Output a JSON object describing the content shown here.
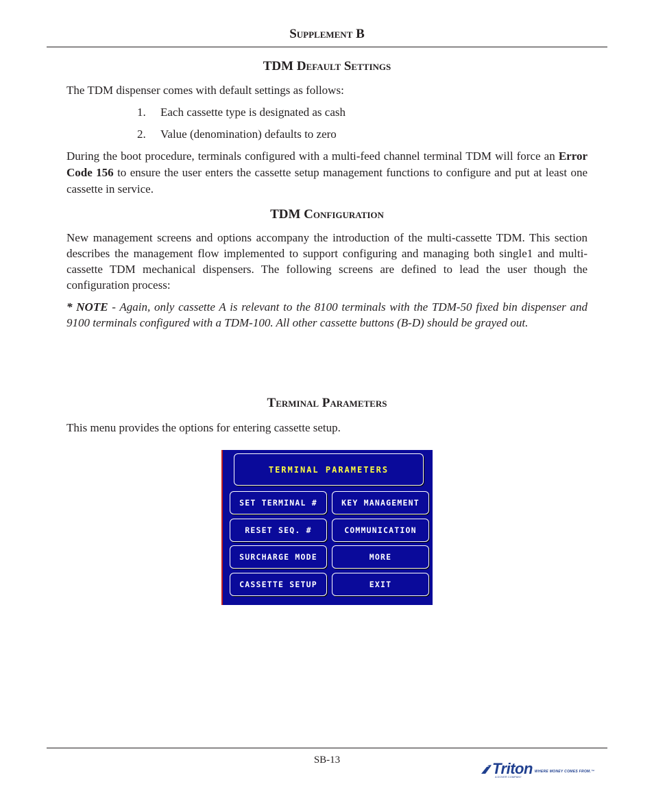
{
  "header": {
    "supplement_title": "Supplement B"
  },
  "sections": {
    "default_settings": {
      "title": "TDM Default Settings",
      "intro": "The TDM dispenser comes with default settings as follows:",
      "list": [
        {
          "num": "1.",
          "text": "Each cassette type is designated as cash"
        },
        {
          "num": "2.",
          "text": "Value (denomination) defaults to zero"
        }
      ],
      "boot_para_before": "During the boot procedure, terminals configured with a multi-feed channel terminal TDM will force an ",
      "boot_para_bold": "Error Code 156",
      "boot_para_after": " to ensure the user enters the cassette setup management functions to configure and put at least one cassette in service."
    },
    "configuration": {
      "title": "TDM Configuration",
      "para": "New management screens and options accompany the introduction of the multi-cassette TDM. This section describes the management flow implemented to support configuring and managing both single1 and multi-cassette TDM mechanical dispensers.  The following screens are defined to lead the user though the configuration process:",
      "note_label": "* NOTE",
      "note_text": " - Again, only cassette A is relevant to the 8100 terminals with the TDM-50 fixed bin dispenser and 9100 terminals configured with a TDM-100.  All other cassette buttons (B-D) should be grayed out."
    },
    "terminal_parameters": {
      "title": "Terminal Parameters",
      "para": "This menu provides the options for entering cassette setup."
    }
  },
  "screen": {
    "title": "TERMINAL PARAMETERS",
    "colors": {
      "background": "#0a0a9a",
      "title_text": "#ffff40",
      "button_text": "#ffffff"
    },
    "buttons_left": [
      "SET TERMINAL #",
      "RESET SEQ. #",
      "SURCHARGE MODE",
      "CASSETTE SETUP"
    ],
    "buttons_right": [
      "KEY MANAGEMENT",
      "COMMUNICATION",
      "MORE",
      "EXIT"
    ]
  },
  "footer": {
    "page_number": "SB-13",
    "logo_text": "Triton",
    "logo_tagline": "WHERE MONEY COMES FROM.™",
    "logo_sub": "A DOVER COMPANY"
  }
}
